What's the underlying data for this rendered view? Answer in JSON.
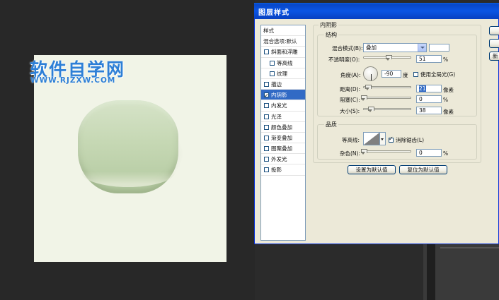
{
  "watermark": {
    "title": "软件自学网",
    "url": "WWW.RJZXW.COM"
  },
  "dialog": {
    "title": "图层样式",
    "styles_list": [
      {
        "label": "样式",
        "checkbox": false,
        "checked": false,
        "indent": false,
        "selected": false,
        "header": true
      },
      {
        "label": "混合选项:默认",
        "checkbox": false,
        "checked": false,
        "indent": false,
        "selected": false,
        "header": true
      },
      {
        "label": "斜面和浮雕",
        "checkbox": true,
        "checked": false,
        "indent": false,
        "selected": false
      },
      {
        "label": "等高线",
        "checkbox": true,
        "checked": false,
        "indent": true,
        "selected": false
      },
      {
        "label": "纹理",
        "checkbox": true,
        "checked": false,
        "indent": true,
        "selected": false
      },
      {
        "label": "描边",
        "checkbox": true,
        "checked": false,
        "indent": false,
        "selected": false
      },
      {
        "label": "内阴影",
        "checkbox": true,
        "checked": true,
        "indent": false,
        "selected": true
      },
      {
        "label": "内发光",
        "checkbox": true,
        "checked": false,
        "indent": false,
        "selected": false
      },
      {
        "label": "光泽",
        "checkbox": true,
        "checked": false,
        "indent": false,
        "selected": false
      },
      {
        "label": "颜色叠加",
        "checkbox": true,
        "checked": false,
        "indent": false,
        "selected": false
      },
      {
        "label": "渐变叠加",
        "checkbox": true,
        "checked": false,
        "indent": false,
        "selected": false
      },
      {
        "label": "图案叠加",
        "checkbox": true,
        "checked": false,
        "indent": false,
        "selected": false
      },
      {
        "label": "外发光",
        "checkbox": true,
        "checked": false,
        "indent": false,
        "selected": false
      },
      {
        "label": "投影",
        "checkbox": true,
        "checked": false,
        "indent": false,
        "selected": false
      }
    ],
    "panel_title": "内阴影",
    "structure": {
      "title": "结构",
      "blend_mode_label": "混合模式(B):",
      "blend_mode_value": "叠加",
      "blend_color": "#ffffff",
      "opacity_label": "不透明度(O):",
      "opacity_value": "51",
      "opacity_unit": "%",
      "opacity_fraction": 0.51,
      "angle_label": "角度(A):",
      "angle_value": "-90",
      "angle_unit": "度",
      "global_light_label": "使用全局光(G)",
      "distance_label": "距离(D):",
      "distance_value": "21",
      "distance_unit": "像素",
      "distance_fraction": 0.084,
      "choke_label": "阻塞(C):",
      "choke_value": "0",
      "choke_unit": "%",
      "choke_fraction": 0,
      "size_label": "大小(S):",
      "size_value": "38",
      "size_unit": "像素",
      "size_fraction": 0.15
    },
    "quality": {
      "title": "品质",
      "contour_label": "等高线:",
      "anti_alias_label": "消除锯齿(L)",
      "anti_alias_checked": true,
      "noise_label": "杂色(N):",
      "noise_value": "0",
      "noise_unit": "%",
      "noise_fraction": 0
    },
    "buttons": {
      "set_default": "设置为默认值",
      "reset_default": "复位为默认值"
    },
    "right_button_partial": "新"
  }
}
